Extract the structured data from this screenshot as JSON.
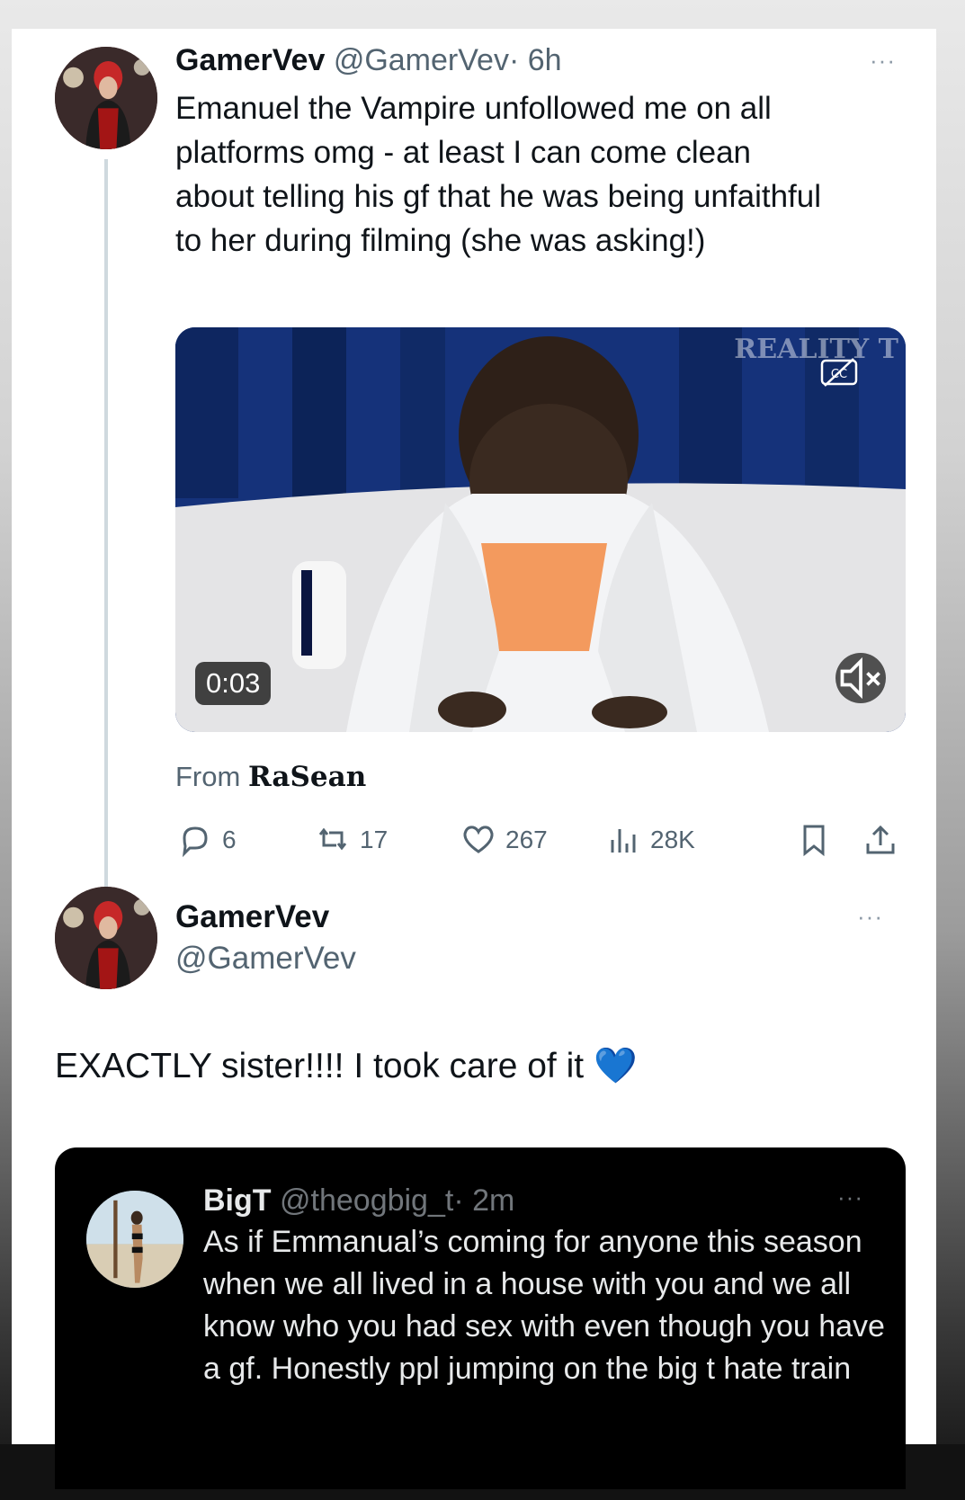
{
  "tweet": {
    "author_name": "GamerVev",
    "author_handle": "@GamerVev",
    "time": "· 6h",
    "more": "···",
    "text": "Emanuel the Vampire unfollowed me on all platforms omg - at least I can come clean about telling his gf that he was being unfaithful to her during filming (she was asking!)",
    "media": {
      "duration": "0:03",
      "watermark": "REALITY T",
      "mute_icon": "mute-icon",
      "cc_icon": "captions-icon"
    },
    "from_prefix": "From",
    "from_name": "RaSean",
    "stats": {
      "replies": "6",
      "retweets": "17",
      "likes": "267",
      "views": "28K"
    }
  },
  "reply": {
    "author_name": "GamerVev",
    "author_handle": "@GamerVev",
    "more": "···",
    "text": "EXACTLY sister!!!! I took care of it",
    "emoji": "💙"
  },
  "quoted": {
    "author_name": "BigT",
    "author_handle": "@theogbig_t",
    "time": "· 2m",
    "more": "···",
    "text": "As if Emmanual’s coming for anyone this season when we all lived in a house with you and we all know who you had sex with even though you have a gf. Honestly ppl jumping on the big t hate train"
  },
  "colors": {
    "text": "#0f1419",
    "muted": "#536471",
    "heart_emoji": "#1d6fe0"
  }
}
